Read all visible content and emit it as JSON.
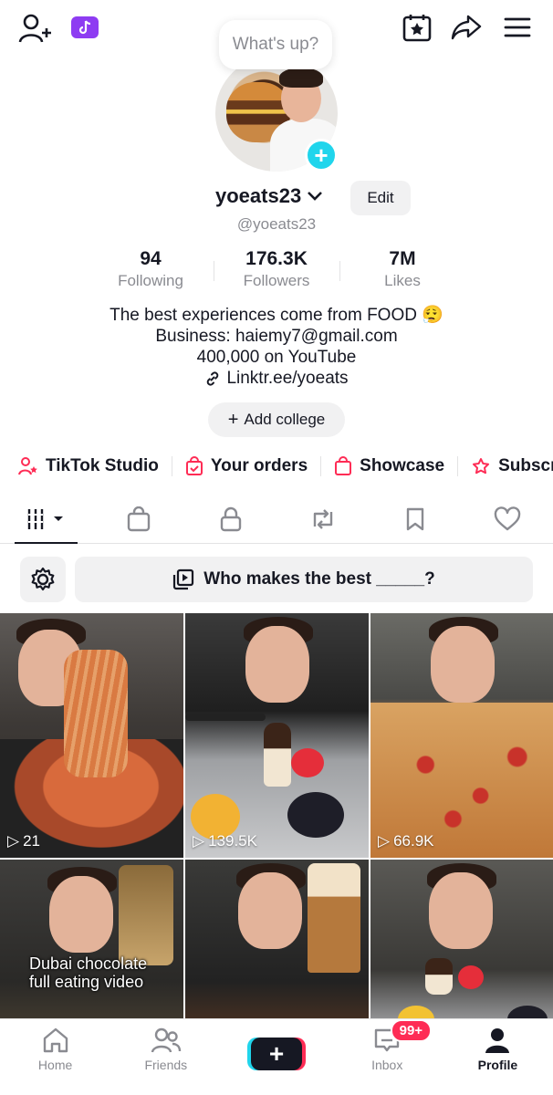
{
  "bubble": {
    "text": "What's up?"
  },
  "profile": {
    "username": "yoeats23",
    "handle": "@yoeats23",
    "edit_label": "Edit"
  },
  "stats": [
    {
      "value": "94",
      "label": "Following"
    },
    {
      "value": "176.3K",
      "label": "Followers"
    },
    {
      "value": "7M",
      "label": "Likes"
    }
  ],
  "bio": {
    "line1": "The best experiences come from FOOD 😮‍💨",
    "line2": "Business: haiemy7@gmail.com",
    "line3": "400,000 on YouTube",
    "link": "Linktr.ee/yoeats"
  },
  "college": {
    "label": "Add college"
  },
  "shortcuts": [
    {
      "label": "TikTok Studio",
      "icon": "person-star-icon"
    },
    {
      "label": "Your orders",
      "icon": "order-bag-icon"
    },
    {
      "label": "Showcase",
      "icon": "shopping-bag-icon"
    },
    {
      "label": "Subscrip",
      "icon": "subscription-icon"
    }
  ],
  "tabs": [
    "videos",
    "shop",
    "private",
    "reposts",
    "favorites",
    "liked"
  ],
  "prompt": {
    "text": "Who makes the best _____?"
  },
  "videos": [
    {
      "views": "21",
      "caption": ""
    },
    {
      "views": "139.5K",
      "caption": ""
    },
    {
      "views": "66.9K",
      "caption": ""
    },
    {
      "views": "",
      "caption": "Dubai chocolate\nfull eating video"
    },
    {
      "views": "",
      "caption": ""
    },
    {
      "views": "",
      "caption": ""
    }
  ],
  "nav": {
    "home": "Home",
    "friends": "Friends",
    "inbox": "Inbox",
    "inbox_badge": "99+",
    "profile": "Profile"
  },
  "colors": {
    "accent_red": "#fe2c55",
    "accent_cyan": "#20d5ec",
    "text_primary": "#161823",
    "text_secondary": "#8a8b91"
  }
}
